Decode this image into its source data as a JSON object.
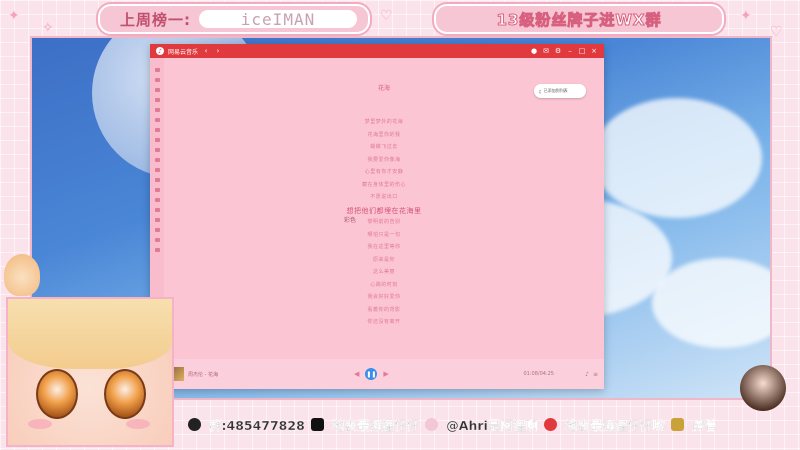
{
  "header": {
    "rank_label": "上周榜一:",
    "rank_name": "iceIMAN",
    "fan_notice": "13级粉丝牌子进WX群"
  },
  "app": {
    "title": "网易云音乐",
    "song_title": "花海",
    "lyric_tag": "彩色",
    "toast_text": "已添加到列表",
    "lyrics": [
      "梦里梦外的花海",
      "花海里你的我",
      "蝴蝶飞过去",
      "我要爱你像海",
      "心里有你才安静",
      "藏在身体里的伤心",
      "不愿说出口",
      "想把他们都埋在花海里",
      "黎明前的告别",
      "哪怕只是一句",
      "我在这里等你",
      "原来是你",
      "这么美丽",
      "心跳的时刻",
      "我会好好爱你",
      "看着你的背影",
      "你还没有离开"
    ],
    "active_index": 7,
    "track": "周杰伦 - 花海",
    "time": "01:08/04:25"
  },
  "bottom": {
    "qq": "群:485477828",
    "douyin": "地表最强狸仔仔",
    "weibo": "@Ahri是阿狸啊",
    "weibo2": "地表最强狸仔仔哟",
    "badge": "房管"
  },
  "colors": {
    "accent": "#e03a3e",
    "pink": "#f7c6d5"
  }
}
